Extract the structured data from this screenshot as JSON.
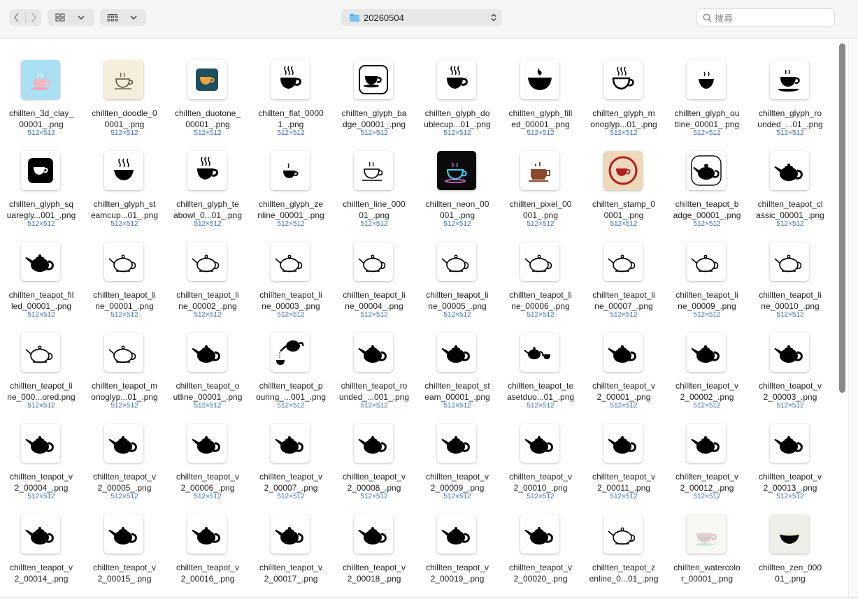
{
  "toolbar": {
    "path_label": "20260504",
    "search_placeholder": "搜尋",
    "icons": {
      "back": "chevron-left-icon",
      "forward": "chevron-right-icon",
      "view": "icon-grid-view-icon",
      "group": "group-view-icon",
      "folder": "folder-icon",
      "search": "search-icon"
    }
  },
  "files": [
    {
      "l1": "chillten_3d_clay_",
      "l2": "00001_.png",
      "d": "512×512",
      "icon": "clay"
    },
    {
      "l1": "chillten_doodle_0",
      "l2": "0001_.png",
      "d": "512×512",
      "icon": "doodle"
    },
    {
      "l1": "chillten_duotone_",
      "l2": "00001_.png",
      "d": "512×512",
      "icon": "duotone"
    },
    {
      "l1": "chillten_flat_0000",
      "l2": "1_.png",
      "d": "512×512",
      "icon": "cup-steam"
    },
    {
      "l1": "chillten_glyph_ba",
      "l2": "dge_00001_.png",
      "d": "512×512",
      "icon": "cup-badge"
    },
    {
      "l1": "chillten_glyph_do",
      "l2": "ublecup...01_.png",
      "d": "512×512",
      "icon": "cup-steam"
    },
    {
      "l1": "chillten_glyph_fill",
      "l2": "ed_00001_.png",
      "d": "512×512",
      "icon": "bowl-flame"
    },
    {
      "l1": "chillten_glyph_m",
      "l2": "onoglyp...01_.png",
      "d": "512×512",
      "icon": "cup-outline"
    },
    {
      "l1": "chillten_glyph_ou",
      "l2": "tline_00001_.png",
      "d": "512×512",
      "icon": "bowl-small"
    },
    {
      "l1": "chillten_glyph_ro",
      "l2": "unded_...01_.png",
      "d": "512×512",
      "icon": "cup-saucer"
    },
    {
      "l1": "chillten_glyph_sq",
      "l2": "uaregly...001_.png",
      "d": "512×512",
      "icon": "cup-square"
    },
    {
      "l1": "chillten_glyph_st",
      "l2": "eamcup...01_.png",
      "d": "512×512",
      "icon": "bowl-steam"
    },
    {
      "l1": "chillten_glyph_te",
      "l2": "abowl_0...01_.png",
      "d": "512×512",
      "icon": "cup-steam"
    },
    {
      "l1": "chillten_glyph_ze",
      "l2": "nline_00001_.png",
      "d": "512×512",
      "icon": "cup-zen"
    },
    {
      "l1": "chillten_line_000",
      "l2": "01_.png",
      "d": "512×512",
      "icon": "cup-line"
    },
    {
      "l1": "chillten_neon_00",
      "l2": "001_.png",
      "d": "512×512",
      "icon": "neon"
    },
    {
      "l1": "chillten_pixel_00",
      "l2": "001_.png",
      "d": "512×512",
      "icon": "pixel"
    },
    {
      "l1": "chillten_stamp_0",
      "l2": "0001_.png",
      "d": "512×512",
      "icon": "stamp"
    },
    {
      "l1": "chillten_teapot_b",
      "l2": "adge_00001_.png",
      "d": "512×512",
      "icon": "teapot-badge"
    },
    {
      "l1": "chillten_teapot_cl",
      "l2": "assic_00001_.png",
      "d": "512×512",
      "icon": "teapot-fill"
    },
    {
      "l1": "chillten_teapot_fil",
      "l2": "led_00001_.png",
      "d": "512×512",
      "icon": "teapot-fill"
    },
    {
      "l1": "chillten_teapot_li",
      "l2": "ne_00001_.png",
      "d": "512×512",
      "icon": "teapot-line"
    },
    {
      "l1": "chillten_teapot_li",
      "l2": "ne_00002_.png",
      "d": "512×512",
      "icon": "teapot-line"
    },
    {
      "l1": "chillten_teapot_li",
      "l2": "ne_00003_.png",
      "d": "512×512",
      "icon": "teapot-line"
    },
    {
      "l1": "chillten_teapot_li",
      "l2": "ne_00004_.png",
      "d": "512×512",
      "icon": "teapot-line"
    },
    {
      "l1": "chillten_teapot_li",
      "l2": "ne_00005_.png",
      "d": "512×512",
      "icon": "teapot-line"
    },
    {
      "l1": "chillten_teapot_li",
      "l2": "ne_00006_.png",
      "d": "512×512",
      "icon": "teapot-line"
    },
    {
      "l1": "chillten_teapot_li",
      "l2": "ne_00007_.png",
      "d": "512×512",
      "icon": "teapot-line"
    },
    {
      "l1": "chillten_teapot_li",
      "l2": "ne_00009_.png",
      "d": "512×512",
      "icon": "teapot-line"
    },
    {
      "l1": "chillten_teapot_li",
      "l2": "ne_00010_.png",
      "d": "512×512",
      "icon": "teapot-line"
    },
    {
      "l1": "chillten_teapot_li",
      "l2": "ne_000...ored.png",
      "d": "512×512",
      "icon": "teapot-line"
    },
    {
      "l1": "chillten_teapot_m",
      "l2": "onoglyp...01_.png",
      "d": "512×512",
      "icon": "teapot-line"
    },
    {
      "l1": "chillten_teapot_o",
      "l2": "utline_00001_.png",
      "d": "512×512",
      "icon": "teapot-fill"
    },
    {
      "l1": "chillten_teapot_p",
      "l2": "ouring_...001_.png",
      "d": "512×512",
      "icon": "teapot-pour"
    },
    {
      "l1": "chillten_teapot_ro",
      "l2": "unded_...001_.png",
      "d": "512×512",
      "icon": "teapot-fill"
    },
    {
      "l1": "chillten_teapot_st",
      "l2": "eam_00001_.png",
      "d": "512×512",
      "icon": "teapot-fill"
    },
    {
      "l1": "chillten_teapot_te",
      "l2": "asetduo...01_.png",
      "d": "512×512",
      "icon": "teaset"
    },
    {
      "l1": "chillten_teapot_v",
      "l2": "2_00001_.png",
      "d": "512×512",
      "icon": "teapot-fill"
    },
    {
      "l1": "chillten_teapot_v",
      "l2": "2_00002_.png",
      "d": "512×512",
      "icon": "teapot-fill"
    },
    {
      "l1": "chillten_teapot_v",
      "l2": "2_00003_.png",
      "d": "512×512",
      "icon": "teapot-fill"
    },
    {
      "l1": "chillten_teapot_v",
      "l2": "2_00004_.png",
      "d": "512×512",
      "icon": "teapot-fill"
    },
    {
      "l1": "chillten_teapot_v",
      "l2": "2_00005_.png",
      "d": "512×512",
      "icon": "teapot-fill"
    },
    {
      "l1": "chillten_teapot_v",
      "l2": "2_00006_.png",
      "d": "512×512",
      "icon": "teapot-fill"
    },
    {
      "l1": "chillten_teapot_v",
      "l2": "2_00007_.png",
      "d": "512×512",
      "icon": "teapot-fill"
    },
    {
      "l1": "chillten_teapot_v",
      "l2": "2_00008_.png",
      "d": "512×512",
      "icon": "teapot-fill"
    },
    {
      "l1": "chillten_teapot_v",
      "l2": "2_00009_.png",
      "d": "512×512",
      "icon": "teapot-fill"
    },
    {
      "l1": "chillten_teapot_v",
      "l2": "2_00010_.png",
      "d": "512×512",
      "icon": "teapot-fill"
    },
    {
      "l1": "chillten_teapot_v",
      "l2": "2_00011_.png",
      "d": "512×512",
      "icon": "teapot-fill"
    },
    {
      "l1": "chillten_teapot_v",
      "l2": "2_00012_.png",
      "d": "512×512",
      "icon": "teapot-fill"
    },
    {
      "l1": "chillten_teapot_v",
      "l2": "2_00013_.png",
      "d": "512×512",
      "icon": "teapot-fill"
    },
    {
      "l1": "chillten_teapot_v",
      "l2": "2_00014_.png",
      "d": "",
      "icon": "teapot-fill"
    },
    {
      "l1": "chillten_teapot_v",
      "l2": "2_00015_.png",
      "d": "",
      "icon": "teapot-fill"
    },
    {
      "l1": "chillten_teapot_v",
      "l2": "2_00016_.png",
      "d": "",
      "icon": "teapot-fill"
    },
    {
      "l1": "chillten_teapot_v",
      "l2": "2_00017_.png",
      "d": "",
      "icon": "teapot-fill"
    },
    {
      "l1": "chillten_teapot_v",
      "l2": "2_00018_.png",
      "d": "",
      "icon": "teapot-fill"
    },
    {
      "l1": "chillten_teapot_v",
      "l2": "2_00019_.png",
      "d": "",
      "icon": "teapot-fill"
    },
    {
      "l1": "chillten_teapot_v",
      "l2": "2_00020_.png",
      "d": "",
      "icon": "teapot-fill"
    },
    {
      "l1": "chillten_teapot_z",
      "l2": "enline_0...01_.png",
      "d": "",
      "icon": "teapot-line"
    },
    {
      "l1": "chillten_watercolo",
      "l2": "r_00001_.png",
      "d": "",
      "icon": "watercolor"
    },
    {
      "l1": "chillten_zen_000",
      "l2": "01_.png",
      "d": "",
      "icon": "zen"
    }
  ]
}
